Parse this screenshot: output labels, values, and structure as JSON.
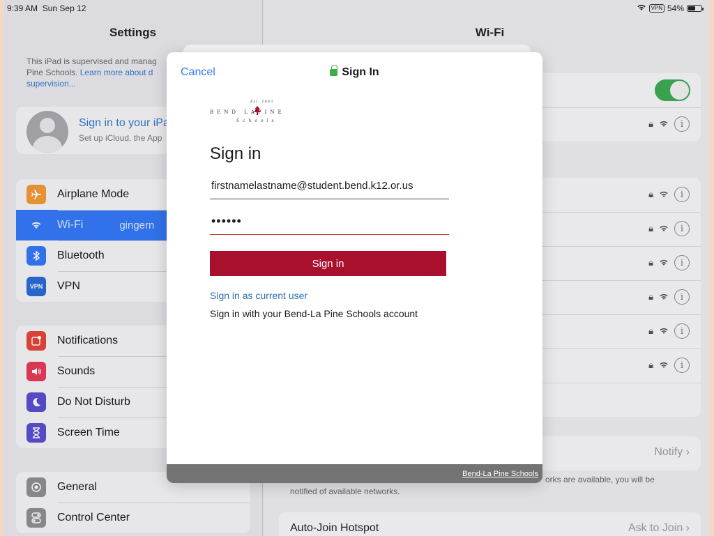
{
  "status_bar": {
    "time": "9:39 AM",
    "date": "Sun Sep 12",
    "vpn": "VPN",
    "battery": "54%"
  },
  "settings": {
    "title": "Settings",
    "supervision_text": "This iPad is supervised and manag",
    "supervision_text_2": "Pine Schools. ",
    "supervision_link": "Learn more about d",
    "supervision_link_2": "supervision...",
    "profile": {
      "title": "Sign in to your iPa",
      "subtitle": "Set up iCloud, the App"
    },
    "groups": [
      [
        {
          "label": "Airplane Mode",
          "icon": "airplane-icon",
          "color": "#f19a37"
        },
        {
          "label": "Wi-Fi",
          "icon": "wifi-icon",
          "color": "#3478f6",
          "value": "gingern",
          "selected": true
        },
        {
          "label": "Bluetooth",
          "icon": "bluetooth-icon",
          "color": "#3478f6"
        },
        {
          "label": "VPN",
          "icon": "vpn-icon",
          "color": "#2a6ad6"
        }
      ],
      [
        {
          "label": "Notifications",
          "icon": "notifications-icon",
          "color": "#e4453b"
        },
        {
          "label": "Sounds",
          "icon": "sounds-icon",
          "color": "#e63a57"
        },
        {
          "label": "Do Not Disturb",
          "icon": "moon-icon",
          "color": "#5a4fcf"
        },
        {
          "label": "Screen Time",
          "icon": "hourglass-icon",
          "color": "#5a4fcf"
        }
      ],
      [
        {
          "label": "General",
          "icon": "gear-icon",
          "color": "#8e8e93"
        },
        {
          "label": "Control Center",
          "icon": "control-center-icon",
          "color": "#8e8e93"
        }
      ]
    ]
  },
  "wifi": {
    "title": "Wi-Fi",
    "notify_value": "Notify",
    "footer_note": "orks are available, you will be",
    "footer_note_2": "notified of available networks.",
    "auto_join_label": "Auto-Join Hotspot",
    "auto_join_value": "Ask to Join"
  },
  "modal": {
    "cancel": "Cancel",
    "title": "Sign In",
    "logo": {
      "est": "Est. 1883",
      "name": "BEND LAPINE",
      "sub": "Schools"
    },
    "heading": "Sign in",
    "email_value": "firstnamelastname@student.bend.k12.or.us",
    "password_value": "••••••",
    "signin_button": "Sign in",
    "current_user_link": "Sign in as current user",
    "hint": "Sign in with your Bend-La Pine Schools account",
    "footer_link": "Bend-La Pine Schools"
  },
  "colors": {
    "accent": "#3478f6",
    "brand": "#a8102e",
    "toggle_on": "#3cab55"
  }
}
